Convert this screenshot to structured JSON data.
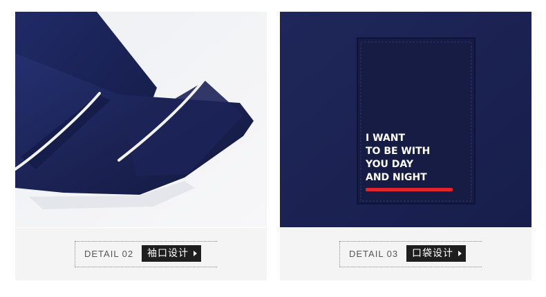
{
  "panels": [
    {
      "name": "cuff-detail",
      "caption": {
        "detail_text": "DETAIL 02",
        "label": "袖口设计"
      }
    },
    {
      "name": "pocket-detail",
      "pocket_print": {
        "lines": [
          "I WANT",
          "TO BE WITH",
          "YOU DAY",
          "AND NIGHT"
        ]
      },
      "caption": {
        "detail_text": "DETAIL 03",
        "label": "口袋设计"
      }
    }
  ],
  "colors": {
    "fabric_navy": "#1a2150",
    "fabric_shadow": "#0f1538",
    "piping_white": "#f3f3f3",
    "accent_red": "#e0252b",
    "caption_bg": "#f4f4f4",
    "label_bg": "#1e1e1e"
  }
}
